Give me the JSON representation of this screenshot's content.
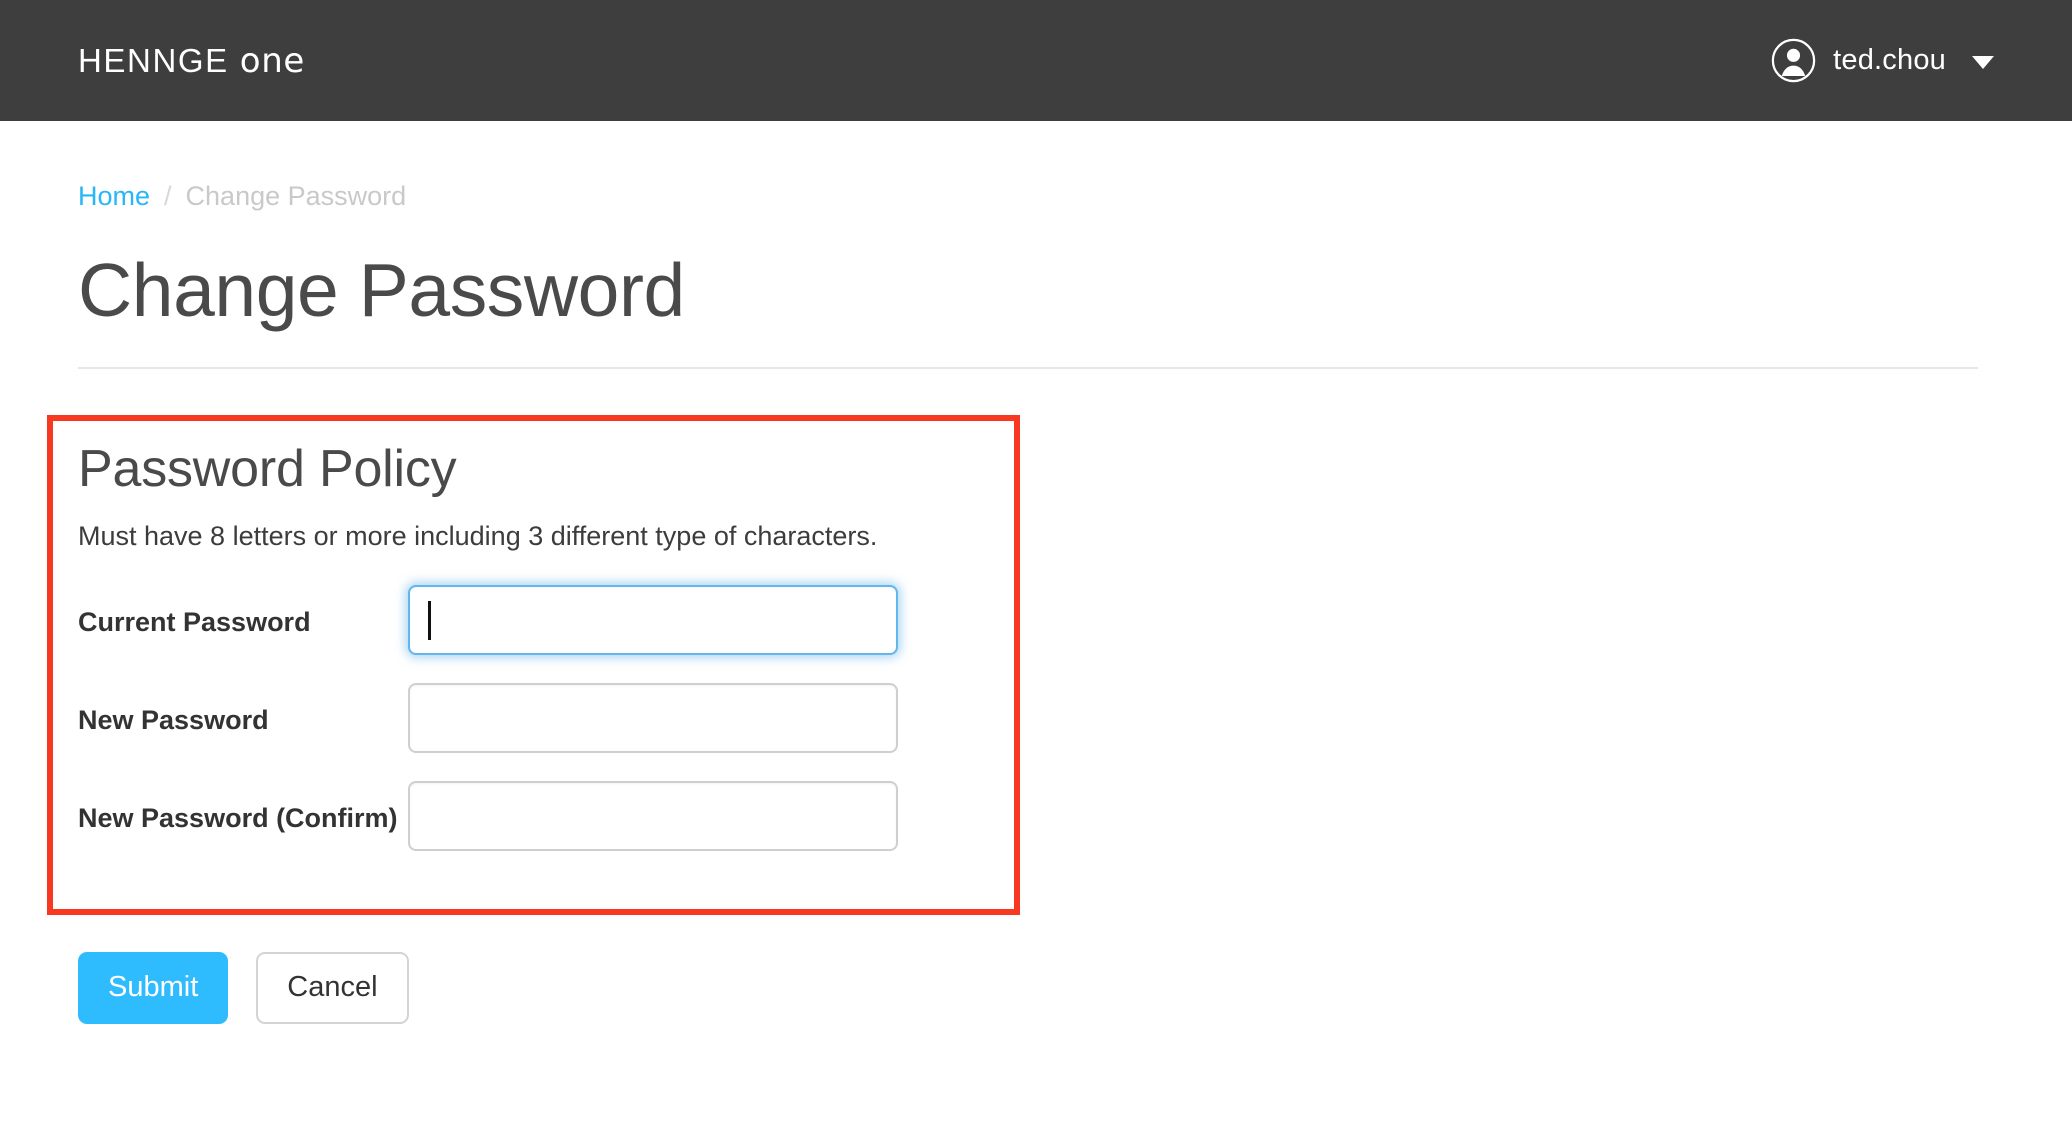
{
  "header": {
    "brand_main": "HENNGE",
    "brand_sub": "one",
    "user_name": "ted.chou",
    "avatar_icon": "user-avatar-icon",
    "caret_icon": "chevron-down-icon",
    "background_color": "#3e3e3e"
  },
  "breadcrumb": {
    "home_label": "Home",
    "separator": "/",
    "current_label": "Change Password",
    "link_color": "#29b6f6"
  },
  "page": {
    "title": "Change Password"
  },
  "policy": {
    "title": "Password Policy",
    "description": "Must have 8 letters or more including 3 different type of characters.",
    "fields": [
      {
        "label": "Current Password",
        "value": "",
        "placeholder": "",
        "focused": true
      },
      {
        "label": "New Password",
        "value": "",
        "placeholder": "",
        "focused": false
      },
      {
        "label": "New Password (Confirm)",
        "value": "",
        "placeholder": "",
        "focused": false
      }
    ]
  },
  "buttons": {
    "submit_label": "Submit",
    "cancel_label": "Cancel",
    "submit_color": "#2fbcff"
  },
  "annotation": {
    "box_color": "#f93822"
  }
}
